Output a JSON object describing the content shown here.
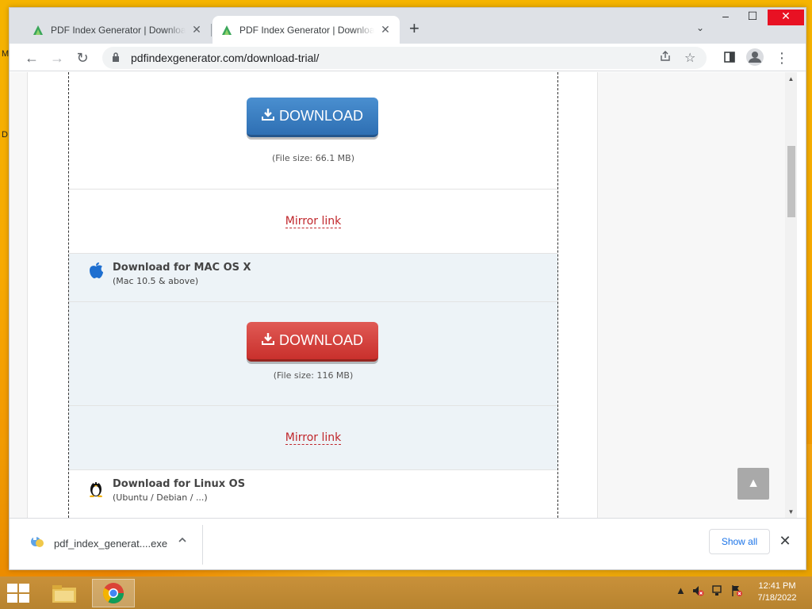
{
  "desktop": {
    "edge_letters": [
      "M",
      "D"
    ]
  },
  "browser": {
    "tabs": [
      {
        "title": "PDF Index Generator | Download",
        "close": "✕",
        "active": false
      },
      {
        "title": "PDF Index Generator | Download",
        "close": "✕",
        "active": true
      }
    ],
    "new_tab": "+",
    "tab_search": "⌄",
    "window_controls": {
      "minimize": "–",
      "maximize": "☐",
      "close": "✕"
    },
    "toolbar": {
      "back": "←",
      "forward": "→",
      "reload": "↻",
      "url": "pdfindexgenerator.com/download-trial/"
    }
  },
  "page": {
    "windows_section": {
      "button_label": "DOWNLOAD",
      "file_size": "(File size: 66.1 MB)",
      "mirror": "Mirror link"
    },
    "mac_section": {
      "title": "Download for MAC OS X",
      "subtitle": "(Mac 10.5 & above)",
      "button_label": "DOWNLOAD",
      "file_size": "(File size: 116 MB)",
      "mirror": "Mirror link"
    },
    "linux_section": {
      "title": "Download for Linux OS",
      "subtitle": "(Ubuntu / Debian / ...)"
    },
    "back_to_top": "▲"
  },
  "download_bar": {
    "file_name": "pdf_index_generat....exe",
    "show_all": "Show all",
    "close": "✕"
  },
  "taskbar": {
    "time": "12:41 PM",
    "date": "7/18/2022"
  },
  "colors": {
    "blue_button": "#2e6fb3",
    "red_button": "#c9302c",
    "mirror_link": "#c0262b",
    "desktop": "#f5b400"
  }
}
